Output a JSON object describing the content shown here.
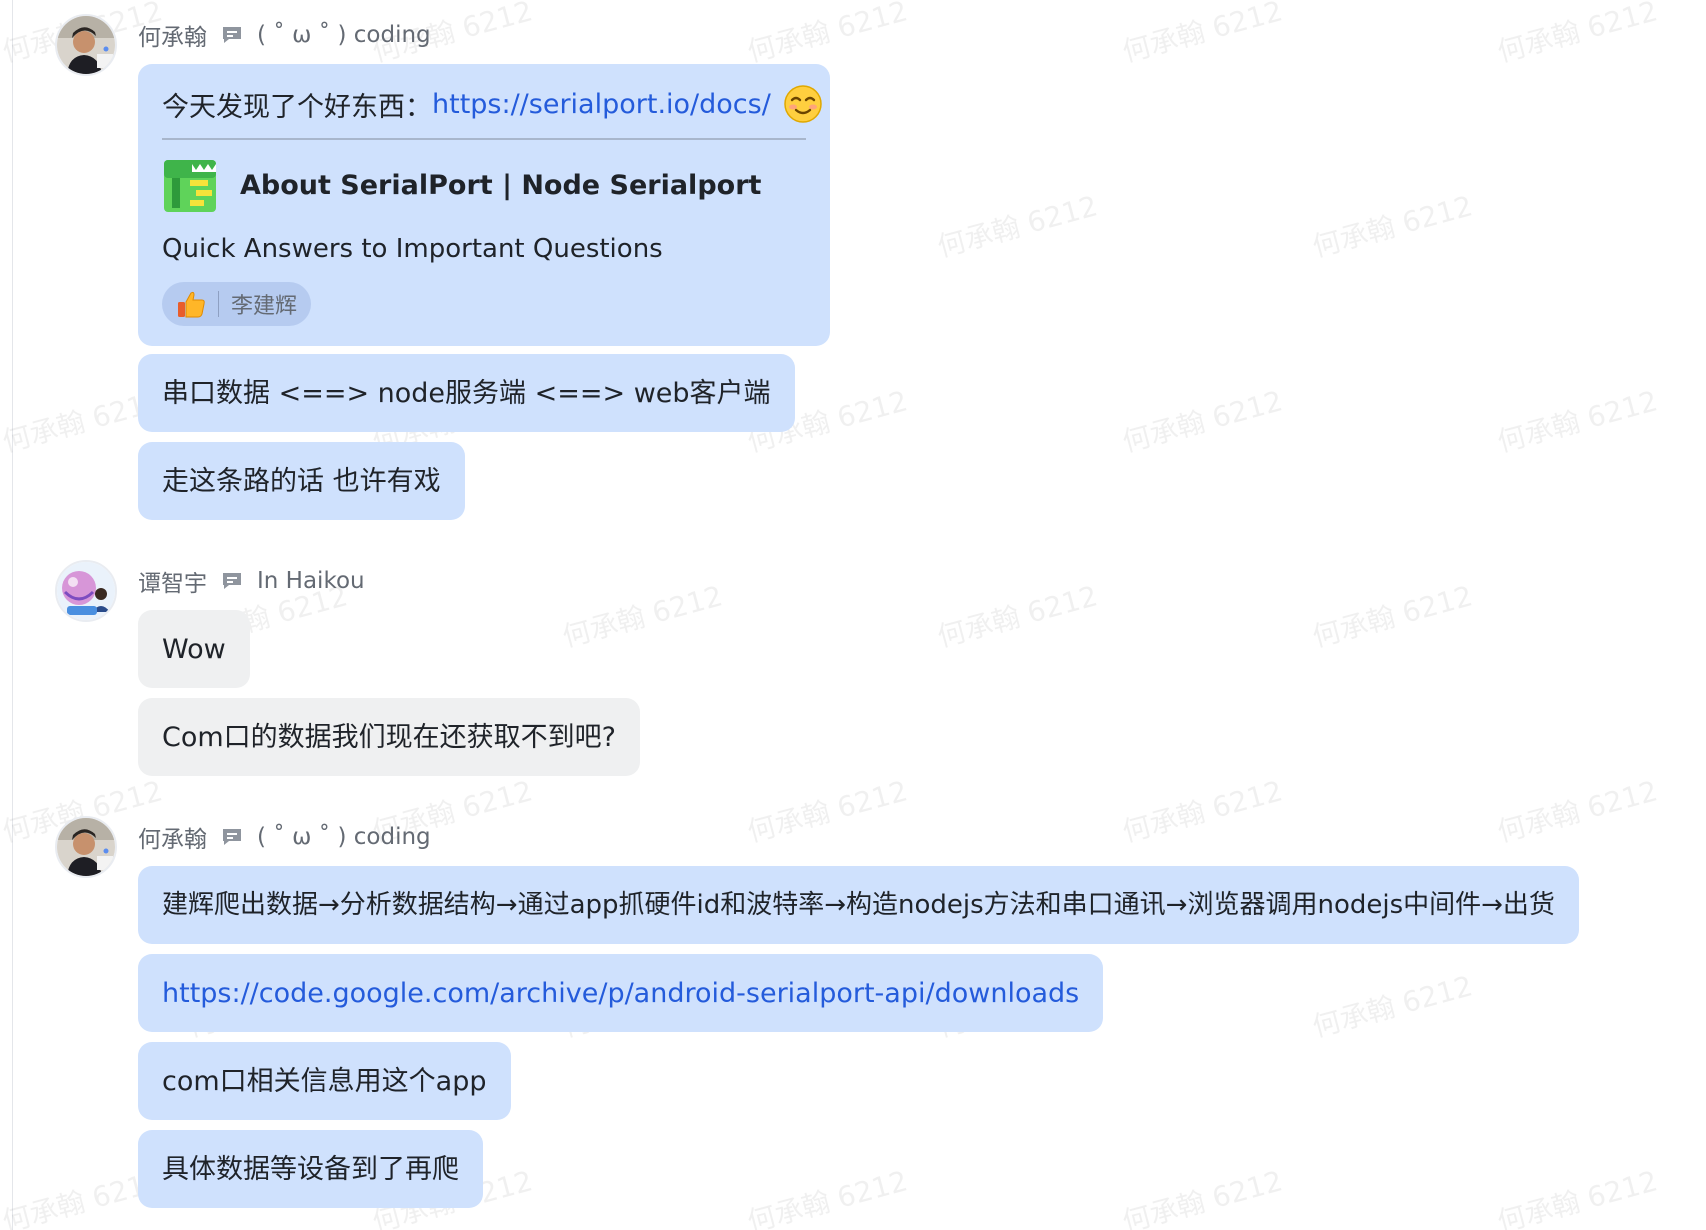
{
  "watermark_text": "何承翰 6212",
  "messages": [
    {
      "sender": "何承翰",
      "status": "( ˚ ω ˚ ) coding",
      "card": {
        "text": "今天发现了个好东西：",
        "link": "https://serialport.io/docs/",
        "emoji": "smiling-face-icon",
        "preview_title": "About SerialPort | Node Serialport",
        "preview_description": "Quick Answers to Important Questions",
        "reaction_user": "李建辉",
        "reaction_icon": "thumbs-up-icon"
      },
      "bubbles": [
        "串口数据 <==> node服务端 <==> web客户端",
        "走这条路的话 也许有戏"
      ]
    },
    {
      "sender": "谭智宇",
      "status": "In Haikou",
      "bubbles": [
        "Wow",
        "Com口的数据我们现在还获取不到吧?"
      ]
    },
    {
      "sender": "何承翰",
      "status": "( ˚ ω ˚ ) coding",
      "bubbles": [
        "建辉爬出数据→分析数据结构→通过app抓硬件id和波特率→构造nodejs方法和串口通讯→浏览器调用nodejs中间件→出货",
        "https://code.google.com/archive/p/android-serialport-api/downloads",
        "com口相关信息用这个app",
        "具体数据等设备到了再爬"
      ]
    }
  ],
  "colors": {
    "own_bubble": "#cfe1fd",
    "other_bubble": "#eff0f1",
    "link": "#245bdb",
    "meta_text": "#646a73"
  }
}
